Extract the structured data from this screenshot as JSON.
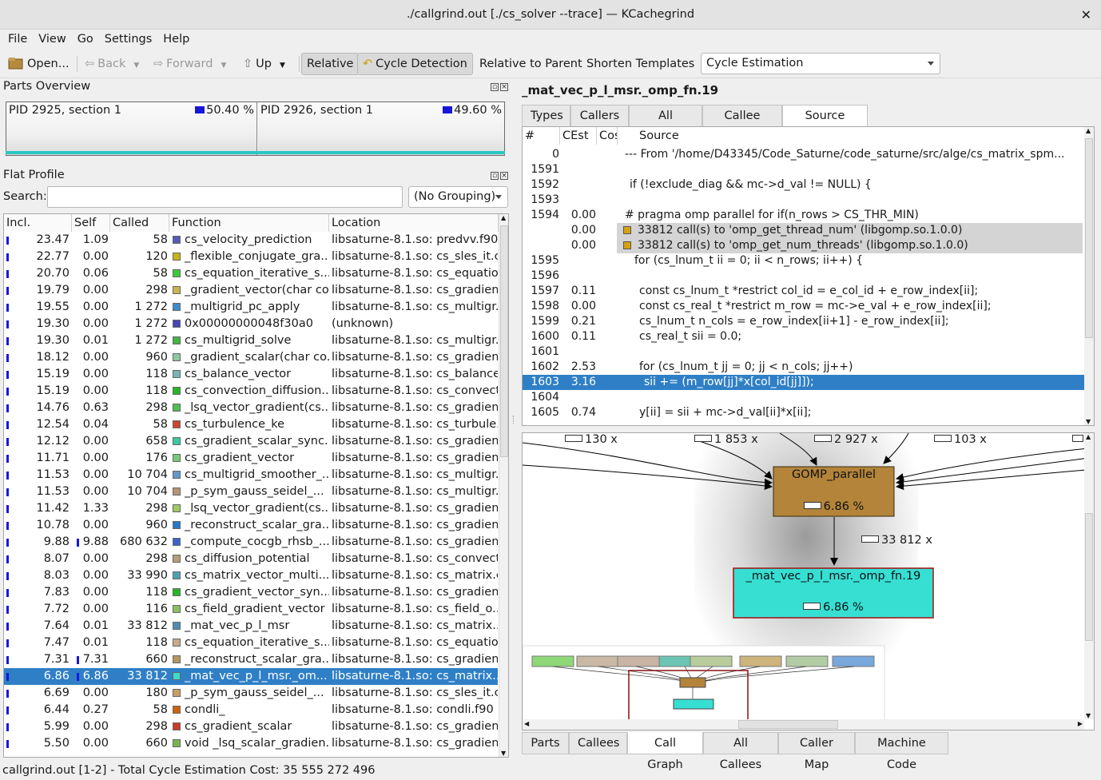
{
  "window": {
    "title": "./callgrind.out [./cs_solver --trace] — KCachegrind"
  },
  "menu": [
    "File",
    "View",
    "Go",
    "Settings",
    "Help"
  ],
  "toolbar": {
    "open": "Open...",
    "back": "Back",
    "forward": "Forward",
    "up": "Up",
    "relative": "Relative",
    "cycle_detection": "Cycle Detection",
    "relative_to_parent": "Relative to Parent",
    "shorten_templates": "Shorten Templates",
    "event_type": "Cycle Estimation"
  },
  "parts_overview": {
    "title": "Parts Overview",
    "parts": [
      {
        "label": "PID 2925, section 1",
        "percent": "50.40 %"
      },
      {
        "label": "PID 2926, section 1",
        "percent": "49.60 %"
      }
    ]
  },
  "flat_profile": {
    "title": "Flat Profile",
    "search_label": "Search:",
    "search_value": "",
    "grouping": "(No Grouping)",
    "columns": [
      "Incl.",
      "Self",
      "Called",
      "Function",
      "Location"
    ],
    "rows": [
      {
        "incl": "23.47",
        "self": "1.09",
        "called": "58",
        "color": "#5a5ab4",
        "fn": "cs_velocity_prediction",
        "loc": "libsaturne-8.1.so: predvv.f90"
      },
      {
        "incl": "22.77",
        "self": "0.00",
        "called": "120",
        "color": "#c8b41e",
        "fn": "_flexible_conjugate_gra...",
        "loc": "libsaturne-8.1.so: cs_sles_it.c"
      },
      {
        "incl": "20.70",
        "self": "0.06",
        "called": "58",
        "color": "#3cc83c",
        "fn": "cs_equation_iterative_s...",
        "loc": "libsaturne-8.1.so: cs_equatio..."
      },
      {
        "incl": "19.79",
        "self": "0.00",
        "called": "298",
        "color": "#c8b450",
        "fn": "_gradient_vector(char co...",
        "loc": "libsaturne-8.1.so: cs_gradien..."
      },
      {
        "incl": "19.55",
        "self": "0.00",
        "called": "1 272",
        "color": "#3c8cc8",
        "fn": "_multigrid_pc_apply",
        "loc": "libsaturne-8.1.so: cs_multigr..."
      },
      {
        "incl": "19.30",
        "self": "0.00",
        "called": "1 272",
        "color": "#4646b4",
        "fn": "0x00000000048f30a0",
        "loc": "(unknown)"
      },
      {
        "incl": "19.30",
        "self": "0.01",
        "called": "1 272",
        "color": "#46b446",
        "fn": "cs_multigrid_solve",
        "loc": "libsaturne-8.1.so: cs_multigr..."
      },
      {
        "incl": "18.12",
        "self": "0.00",
        "called": "960",
        "color": "#8cc8a0",
        "fn": "_gradient_scalar(char co...",
        "loc": "libsaturne-8.1.so: cs_gradien..."
      },
      {
        "incl": "15.19",
        "self": "0.00",
        "called": "118",
        "color": "#78b4b4",
        "fn": "cs_balance_vector",
        "loc": "libsaturne-8.1.so: cs_balance..."
      },
      {
        "incl": "15.19",
        "self": "0.00",
        "called": "118",
        "color": "#28b428",
        "fn": "cs_convection_diffusion...",
        "loc": "libsaturne-8.1.so: cs_convect..."
      },
      {
        "incl": "14.76",
        "self": "0.63",
        "called": "298",
        "color": "#50be50",
        "fn": "_lsq_vector_gradient(cs...",
        "loc": "libsaturne-8.1.so: cs_gradien..."
      },
      {
        "incl": "12.54",
        "self": "0.04",
        "called": "58",
        "color": "#c84632",
        "fn": "cs_turbulence_ke",
        "loc": "libsaturne-8.1.so: cs_turbule..."
      },
      {
        "incl": "12.12",
        "self": "0.00",
        "called": "658",
        "color": "#3cc8a0",
        "fn": "cs_gradient_scalar_sync...",
        "loc": "libsaturne-8.1.so: cs_gradien..."
      },
      {
        "incl": "11.71",
        "self": "0.00",
        "called": "176",
        "color": "#78c878",
        "fn": "cs_gradient_vector",
        "loc": "libsaturne-8.1.so: cs_gradien..."
      },
      {
        "incl": "11.53",
        "self": "0.00",
        "called": "10 704",
        "color": "#6496c8",
        "fn": "cs_multigrid_smoother_...",
        "loc": "libsaturne-8.1.so: cs_multigr..."
      },
      {
        "incl": "11.53",
        "self": "0.00",
        "called": "10 704",
        "color": "#b49678",
        "fn": "_p_sym_gauss_seidel_...",
        "loc": "libsaturne-8.1.so: cs_multigr..."
      },
      {
        "incl": "11.42",
        "self": "1.33",
        "called": "298",
        "color": "#a0c864",
        "fn": "_lsq_vector_gradient(cs...",
        "loc": "libsaturne-8.1.so: cs_gradien..."
      },
      {
        "incl": "10.78",
        "self": "0.00",
        "called": "960",
        "color": "#2878c8",
        "fn": "_reconstruct_scalar_gra...",
        "loc": "libsaturne-8.1.so: cs_gradien..."
      },
      {
        "incl": "9.88",
        "self": "9.88",
        "called": "680 632",
        "color": "#3c64c8",
        "fn": "_compute_cocgb_rhsb_...",
        "loc": "libsaturne-8.1.so: cs_gradien..."
      },
      {
        "incl": "8.07",
        "self": "0.00",
        "called": "298",
        "color": "#b4a078",
        "fn": "cs_diffusion_potential",
        "loc": "libsaturne-8.1.so: cs_convect..."
      },
      {
        "incl": "8.03",
        "self": "0.00",
        "called": "33 990",
        "color": "#50a0b4",
        "fn": "cs_matrix_vector_multi...",
        "loc": "libsaturne-8.1.so: cs_matrix.c"
      },
      {
        "incl": "7.83",
        "self": "0.00",
        "called": "118",
        "color": "#28b428",
        "fn": "cs_gradient_vector_syn...",
        "loc": "libsaturne-8.1.so: cs_gradien..."
      },
      {
        "incl": "7.72",
        "self": "0.00",
        "called": "116",
        "color": "#8cbe64",
        "fn": "cs_field_gradient_vector",
        "loc": "libsaturne-8.1.so: cs_field_o..."
      },
      {
        "incl": "7.64",
        "self": "0.01",
        "called": "33 812",
        "color": "#508cb4",
        "fn": "_mat_vec_p_l_msr",
        "loc": "libsaturne-8.1.so: cs_matrix..."
      },
      {
        "incl": "7.47",
        "self": "0.01",
        "called": "118",
        "color": "#c8aa8c",
        "fn": "cs_equation_iterative_s...",
        "loc": "libsaturne-8.1.so: cs_equatio..."
      },
      {
        "incl": "7.31",
        "self": "7.31",
        "called": "660",
        "color": "#b49664",
        "fn": "_reconstruct_scalar_gra...",
        "loc": "libsaturne-8.1.so: cs_gradien..."
      },
      {
        "incl": "6.86",
        "self": "6.86",
        "called": "33 812",
        "color": "#3cdcc8",
        "fn": "_mat_vec_p_l_msr._om...",
        "loc": "libsaturne-8.1.so: cs_matrix..."
      },
      {
        "incl": "6.69",
        "self": "0.00",
        "called": "180",
        "color": "#c8a064",
        "fn": "_p_sym_gauss_seidel_...",
        "loc": "libsaturne-8.1.so: cs_sles_it.c"
      },
      {
        "incl": "6.44",
        "self": "0.27",
        "called": "58",
        "color": "#c86414",
        "fn": "condli_",
        "loc": "libsaturne-8.1.so: condli.f90"
      },
      {
        "incl": "5.99",
        "self": "0.00",
        "called": "298",
        "color": "#c83c28",
        "fn": "cs_gradient_scalar",
        "loc": "libsaturne-8.1.so: cs_gradien..."
      },
      {
        "incl": "5.50",
        "self": "0.00",
        "called": "660",
        "color": "#78b450",
        "fn": "void _lsq_scalar_gradien...",
        "loc": "libsaturne-8.1.so: cs_gradien..."
      }
    ],
    "selected_index": 26
  },
  "source": {
    "function_title": "_mat_vec_p_l_msr._omp_fn.19",
    "tabs": [
      "Types",
      "Callers",
      "All Callers",
      "Callee Map",
      "Source Code"
    ],
    "active_tab": "Source Code",
    "columns": [
      "#",
      "CEst",
      "Cos",
      "Source"
    ],
    "lines": [
      {
        "n": "0",
        "c": "",
        "s": "--- From '/home/D43345/Code_Saturne/code_saturne/src/alge/cs_matrix_spm...",
        "kind": "normal",
        "indent": 0
      },
      {
        "n": "1591",
        "c": "",
        "s": "",
        "kind": "normal",
        "indent": 0
      },
      {
        "n": "1592",
        "c": "",
        "s": "if (!exclude_diag && mc->d_val != NULL) {",
        "kind": "normal",
        "indent": 1
      },
      {
        "n": "1593",
        "c": "",
        "s": "",
        "kind": "normal",
        "indent": 0
      },
      {
        "n": "1594",
        "c": "0.00",
        "s": "#  pragma omp parallel for  if(n_rows > CS_THR_MIN)",
        "kind": "normal",
        "indent": 0
      },
      {
        "n": "",
        "c": "0.00",
        "s": "33812 call(s) to 'omp_get_thread_num' (libgomp.so.1.0.0)",
        "kind": "call",
        "indent": 0
      },
      {
        "n": "",
        "c": "0.00",
        "s": "33812 call(s) to 'omp_get_num_threads' (libgomp.so.1.0.0)",
        "kind": "call",
        "indent": 0
      },
      {
        "n": "1595",
        "c": "",
        "s": "for (cs_lnum_t ii = 0; ii < n_rows; ii++) {",
        "kind": "normal",
        "indent": 2
      },
      {
        "n": "1596",
        "c": "",
        "s": "",
        "kind": "normal",
        "indent": 0
      },
      {
        "n": "1597",
        "c": "0.11",
        "s": "const cs_lnum_t *restrict col_id = e_col_id + e_row_index[ii];",
        "kind": "normal",
        "indent": 3
      },
      {
        "n": "1598",
        "c": "0.00",
        "s": "const cs_real_t *restrict m_row = mc->e_val + e_row_index[ii];",
        "kind": "normal",
        "indent": 3
      },
      {
        "n": "1599",
        "c": "0.21",
        "s": "cs_lnum_t n_cols = e_row_index[ii+1] - e_row_index[ii];",
        "kind": "normal",
        "indent": 3
      },
      {
        "n": "1600",
        "c": "0.11",
        "s": "cs_real_t sii = 0.0;",
        "kind": "normal",
        "indent": 3
      },
      {
        "n": "1601",
        "c": "",
        "s": "",
        "kind": "normal",
        "indent": 0
      },
      {
        "n": "1602",
        "c": "2.53",
        "s": "for (cs_lnum_t jj = 0; jj < n_cols; jj++)",
        "kind": "normal",
        "indent": 3
      },
      {
        "n": "1603",
        "c": "3.16",
        "s": "sii += (m_row[jj]*x[col_id[jj]]);",
        "kind": "selected",
        "indent": 4
      },
      {
        "n": "1604",
        "c": "",
        "s": "",
        "kind": "normal",
        "indent": 0
      },
      {
        "n": "1605",
        "c": "0.74",
        "s": "y[ii] = sii + mc->d_val[ii]*x[ii];",
        "kind": "normal",
        "indent": 3
      }
    ]
  },
  "call_graph": {
    "top_call_counts": [
      "130 x",
      "1 853 x",
      "2 927 x",
      "103 x"
    ],
    "caller_node": {
      "name": "GOMP_parallel",
      "percent": "6.86 %",
      "color": "#b3843a"
    },
    "edge_count": "33 812 x",
    "callee_node": {
      "name": "_mat_vec_p_l_msr._omp_fn.19",
      "percent": "6.86 %",
      "color": "#37dfd3"
    },
    "overview_colors": [
      "#8ed878",
      "#c8b8a4",
      "#c8b4a4",
      "#6cc4b4",
      "#b8cc9c",
      "#cdb47c",
      "#b4cca4",
      "#78a8dc"
    ]
  },
  "bottom_tabs": [
    "Parts",
    "Callees",
    "Call Graph",
    "All Callees",
    "Caller Map",
    "Machine Code"
  ],
  "bottom_active": "Call Graph",
  "status": "callgrind.out [1-2] - Total Cycle Estimation Cost: 35 555 272 496"
}
